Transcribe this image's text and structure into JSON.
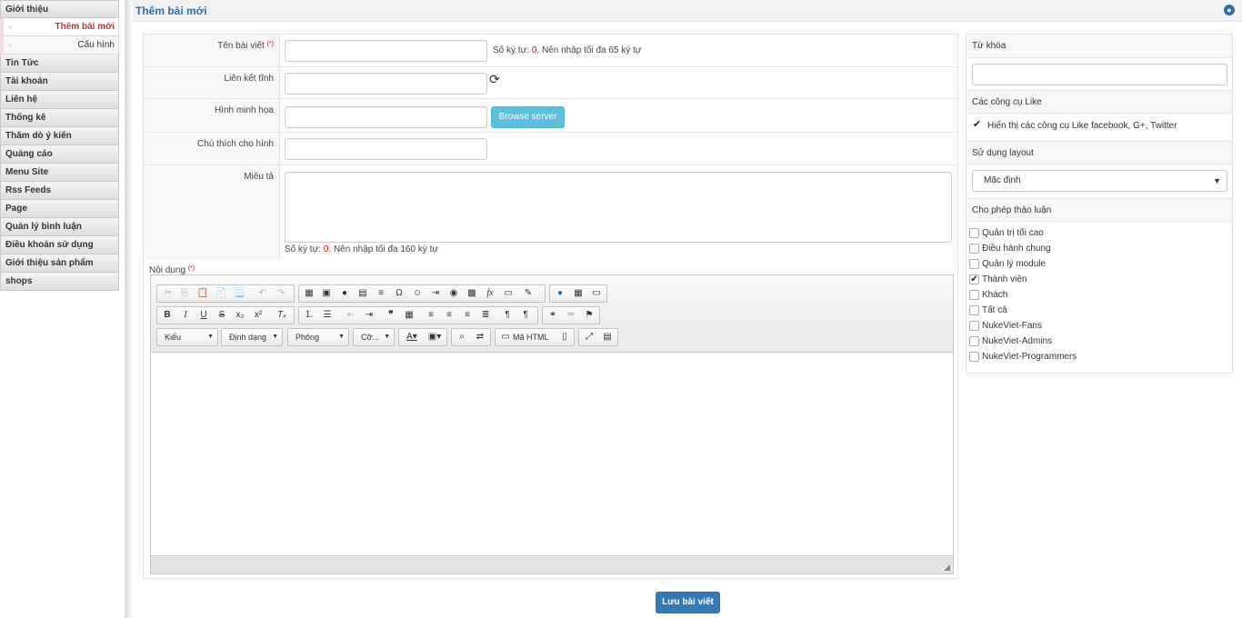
{
  "sidebar": {
    "top_item": "Giới thiệu",
    "sub_items": [
      "Thêm bài mới",
      "Cấu hình"
    ],
    "items": [
      "Tin Tức",
      "Tài khoản",
      "Liên hệ",
      "Thống kê",
      "Thăm dò ý kiến",
      "Quảng cáo",
      "Menu Site",
      "Rss Feeds",
      "Page",
      "Quản lý bình luận",
      "Điều khoản sử dụng",
      "Giới thiệu sản phẩm",
      "shops"
    ]
  },
  "header": {
    "title": "Thêm bài mới"
  },
  "form": {
    "title_label": "Tên bài viết",
    "required_mark": "(*)",
    "title_hint_prefix": "Số ký tự:",
    "title_hint_count": "0.",
    "title_hint_suffix": "Nên nhập tối đa 65 ký tự",
    "alias_label": "Liên kết tĩnh",
    "image_label": "Hình minh họa",
    "browse_label": "Browse server",
    "caption_label": "Chú thích cho hình",
    "desc_label": "Miêu tả",
    "desc_hint_prefix": "Số ký tự:",
    "desc_hint_count": "0.",
    "desc_hint_suffix": "Nên nhập tối đa 160 ký tự",
    "content_label": "Nội dung"
  },
  "editor": {
    "combos": [
      "Kiểu",
      "Định dạng",
      "Phông",
      "Cỡ..."
    ],
    "source_label": "Mã HTML"
  },
  "right": {
    "keywords_label": "Từ khóa",
    "like_tools_label": "Các công cụ Like",
    "like_option": "Hiển thị các công cụ Like facebook, G+, Twitter",
    "layout_label": "Sử dụng layout",
    "layout_value": "Mặc định",
    "discussion_label": "Cho phép thảo luận",
    "groups": [
      {
        "label": "Quản trị tối cao",
        "checked": false
      },
      {
        "label": "Điều hành chung",
        "checked": false
      },
      {
        "label": "Quản lý module",
        "checked": false
      },
      {
        "label": "Thành viên",
        "checked": true
      },
      {
        "label": "Khách",
        "checked": false
      },
      {
        "label": "Tất cả",
        "checked": false
      },
      {
        "label": "NukeViet-Fans",
        "checked": false
      },
      {
        "label": "NukeViet-Admins",
        "checked": false
      },
      {
        "label": "NukeViet-Programmers",
        "checked": false
      }
    ]
  },
  "save_label": "Lưu bài viết"
}
